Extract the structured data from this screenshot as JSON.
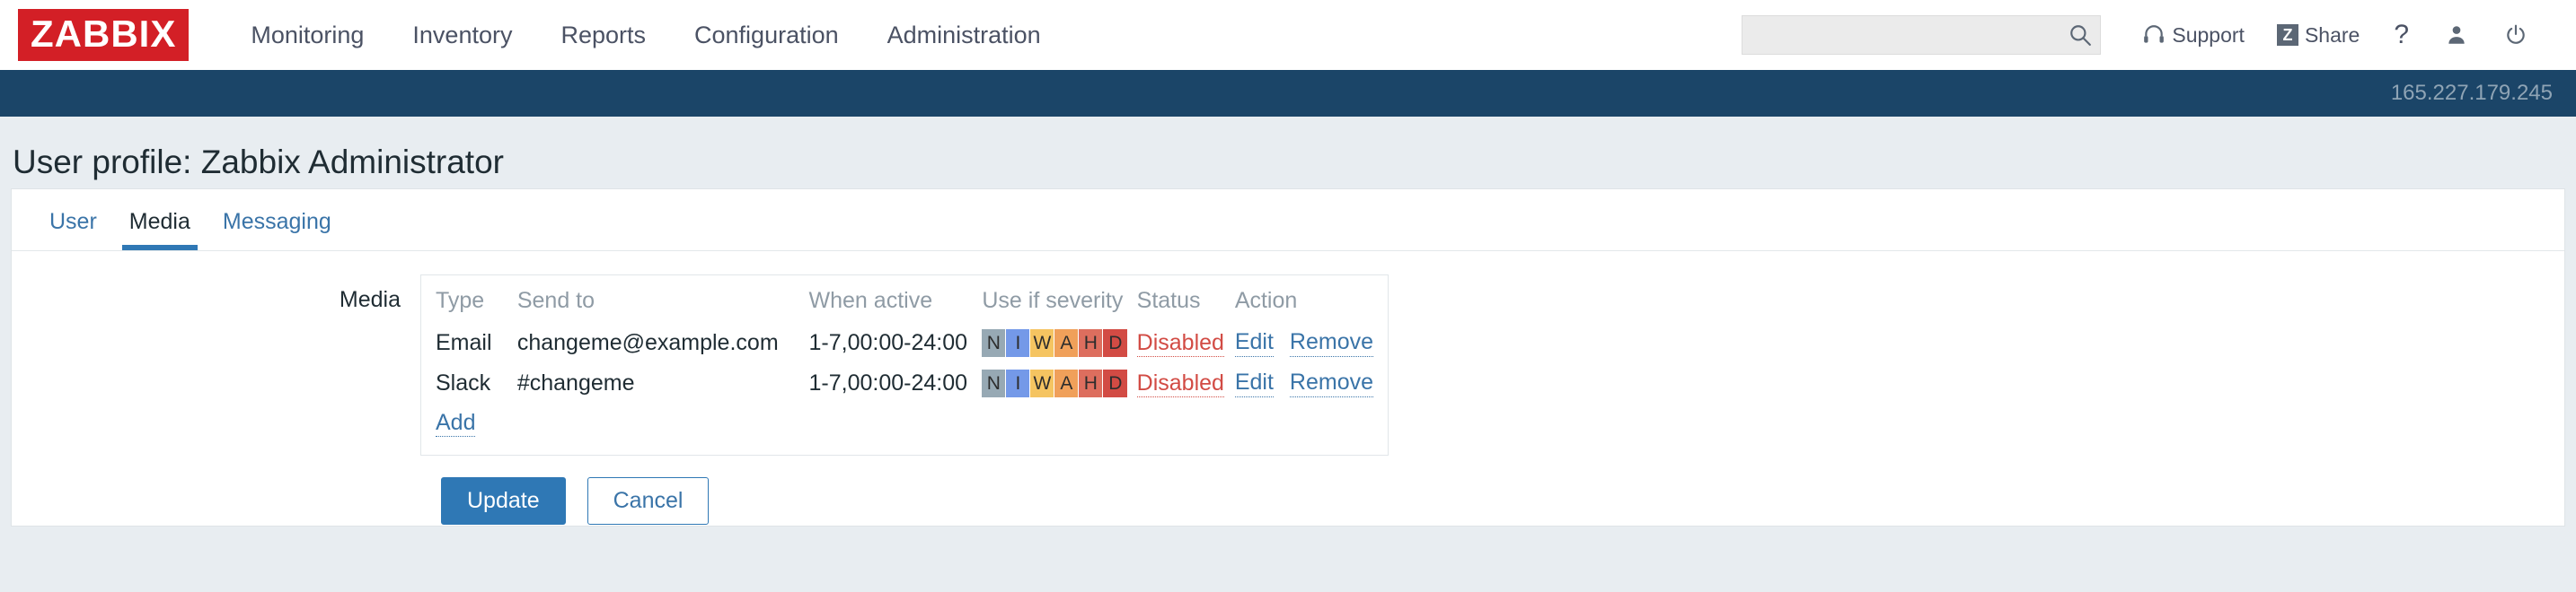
{
  "brand": {
    "logo_text": "ZABBIX",
    "logo_bg": "#d31f26"
  },
  "nav": {
    "items": [
      {
        "label": "Monitoring"
      },
      {
        "label": "Inventory"
      },
      {
        "label": "Reports"
      },
      {
        "label": "Configuration"
      },
      {
        "label": "Administration"
      }
    ]
  },
  "search": {
    "value": "",
    "placeholder": ""
  },
  "utility": {
    "support_label": "Support",
    "share_label": "Share",
    "share_badge": "Z",
    "help_label": "?"
  },
  "hostbar": {
    "address": "165.227.179.245"
  },
  "page": {
    "title": "User profile: Zabbix Administrator"
  },
  "tabs": [
    {
      "label": "User",
      "active": false
    },
    {
      "label": "Media",
      "active": true
    },
    {
      "label": "Messaging",
      "active": false
    }
  ],
  "form": {
    "media_label": "Media",
    "add_label": "Add",
    "update_label": "Update",
    "cancel_label": "Cancel"
  },
  "media_table": {
    "columns": [
      "Type",
      "Send to",
      "When active",
      "Use if severity",
      "Status",
      "Action"
    ],
    "severity_codes": [
      "N",
      "I",
      "W",
      "A",
      "H",
      "D"
    ],
    "severity_colors": [
      "#97a9b4",
      "#7499e8",
      "#f5c461",
      "#f0a05a",
      "#dd6e5e",
      "#d24b44"
    ],
    "rows": [
      {
        "type": "Email",
        "send_to": "changeme@example.com",
        "when_active": "1-7,00:00-24:00",
        "status": "Disabled",
        "edit_label": "Edit",
        "remove_label": "Remove"
      },
      {
        "type": "Slack",
        "send_to": "#changeme",
        "when_active": "1-7,00:00-24:00",
        "status": "Disabled",
        "edit_label": "Edit",
        "remove_label": "Remove"
      }
    ]
  },
  "colors": {
    "accent": "#2f78b5",
    "brand_red": "#d31f26",
    "hostbar_bg": "#1b4568",
    "page_bg": "#e8edf1",
    "danger": "#d24b44"
  }
}
